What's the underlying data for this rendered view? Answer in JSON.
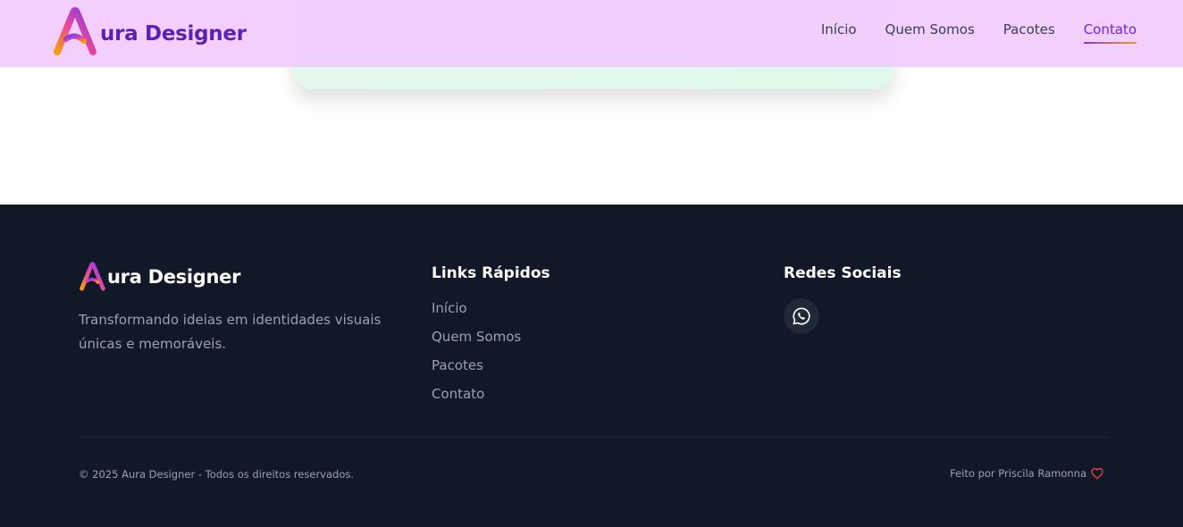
{
  "header": {
    "brand_text": "ura Designer",
    "nav": [
      {
        "label": "Início"
      },
      {
        "label": "Quem Somos"
      },
      {
        "label": "Pacotes"
      },
      {
        "label": "Contato",
        "active": true
      }
    ]
  },
  "footer": {
    "brand_text": "ura Designer",
    "description": "Transformando ideias em identidades visuais únicas e memoráveis.",
    "quick_links": {
      "heading": "Links Rápidos",
      "items": [
        "Início",
        "Quem Somos",
        "Pacotes",
        "Contato"
      ]
    },
    "social": {
      "heading": "Redes Sociais",
      "icons": [
        "whatsapp-icon"
      ]
    },
    "copyright": "© 2025 Aura Designer - Todos os direitos reservados.",
    "made_by": "Feito por Priscila Ramonna"
  },
  "colors": {
    "header_bg": "#f1cdfc",
    "brand_purple": "#5b21b6",
    "footer_bg": "#111827",
    "heart": "#ef4444"
  }
}
